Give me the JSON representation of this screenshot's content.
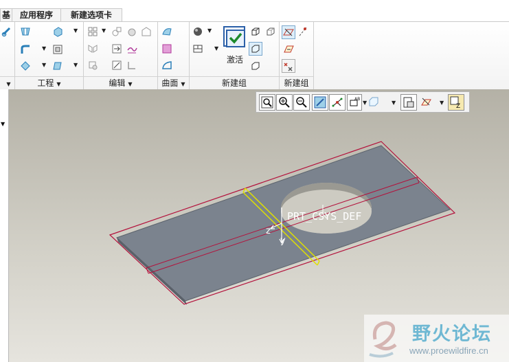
{
  "tabs": [
    {
      "label": "基"
    },
    {
      "label": "应用程序"
    },
    {
      "label": "新建选项卡"
    }
  ],
  "ribbon": {
    "groups": [
      {
        "label": "",
        "has_menu": true
      },
      {
        "label": "工程",
        "has_menu": true
      },
      {
        "label": "编辑",
        "has_menu": true
      },
      {
        "label": "曲面",
        "has_menu": true
      },
      {
        "label": "新建组",
        "has_menu": false
      },
      {
        "label": "新建组",
        "has_menu": false
      }
    ],
    "activate_label": "激活"
  },
  "model": {
    "csys_name": "PRT_CSYS_DEF",
    "axis_z": "z",
    "axis_y": "y"
  },
  "watermark": {
    "title": "野火论坛",
    "url": "www.proewildfire.cn"
  },
  "colors": {
    "part_surface": "#7b838e",
    "edge_highlight": "#b3123c",
    "datum_plane": "#e0e000",
    "watermark_text": "#6fb8d3"
  }
}
